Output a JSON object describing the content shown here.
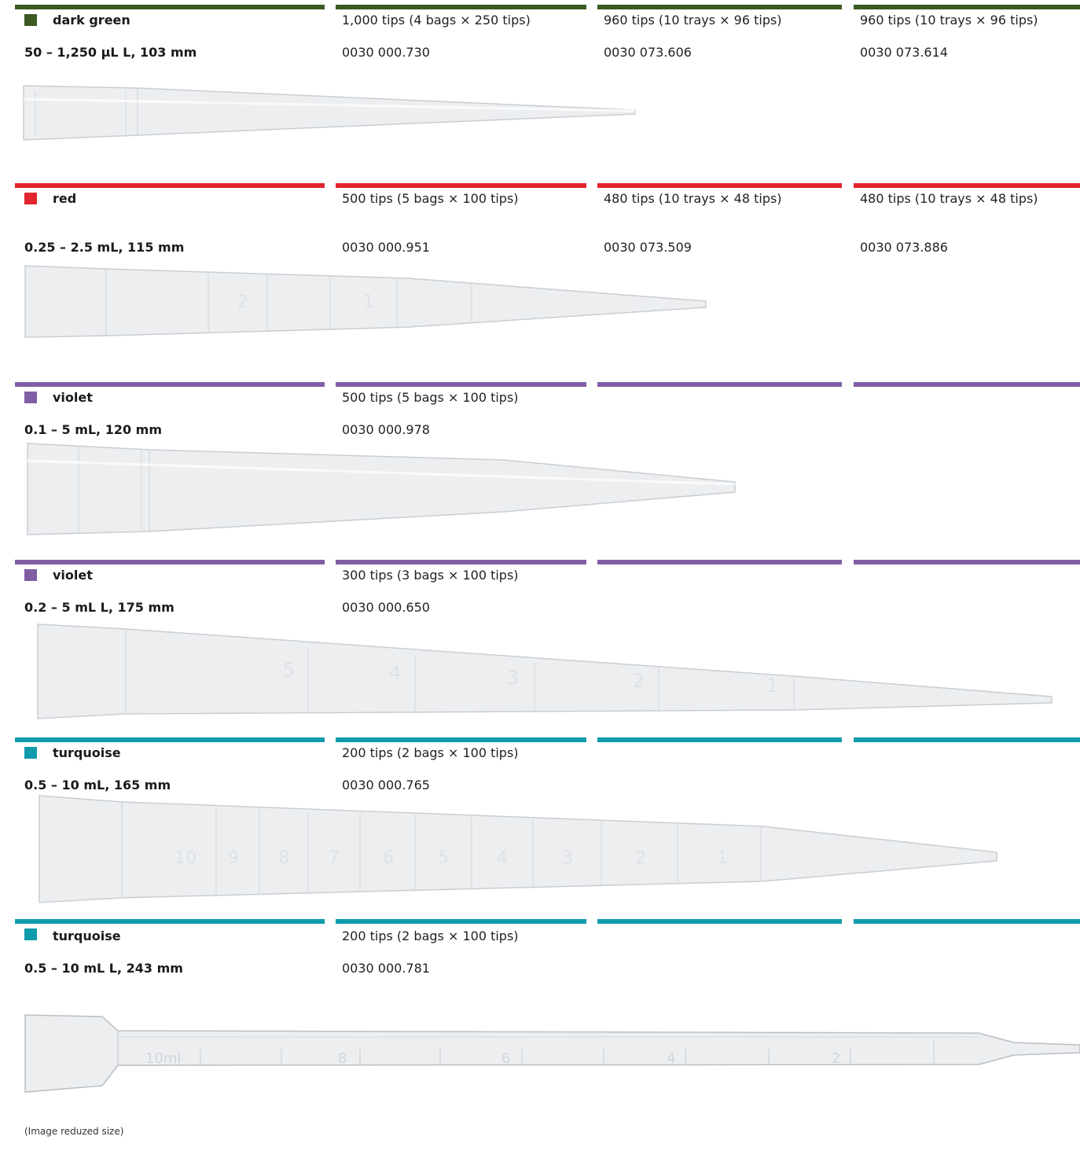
{
  "colors": {
    "dark_green": "#3c5a21",
    "red": "#e1242e",
    "violet": "#7f5ea4",
    "turquoise": "#0f9bab"
  },
  "rows": [
    {
      "color_name": "dark green",
      "spec": "50 – 1,250 µL L, 103 mm",
      "pack_1": "1,000 tips (4 bags × 250 tips)",
      "pack_2": "960 tips (10 trays × 96 tips)",
      "pack_3": "960 tips (10 trays × 96 tips)",
      "order_1": "0030 000.730",
      "order_2": "0030 073.606",
      "order_3": "0030 073.614"
    },
    {
      "color_name": "red",
      "spec": "0.25 – 2.5 mL, 115 mm",
      "pack_1": "500 tips (5 bags × 100 tips)",
      "pack_2": "480 tips (10 trays × 48 tips)",
      "pack_3": "480 tips (10 trays × 48 tips)",
      "order_1": "0030 000.951",
      "order_2": "0030 073.509",
      "order_3": "0030 073.886",
      "marks": [
        "2",
        "1"
      ]
    },
    {
      "color_name": "violet",
      "spec": "0.1 – 5 mL, 120 mm",
      "pack_1": "500 tips (5 bags × 100 tips)",
      "order_1": "0030 000.978"
    },
    {
      "color_name": "violet",
      "spec": "0.2 – 5 mL L, 175 mm",
      "pack_1": "300 tips (3 bags × 100 tips)",
      "order_1": "0030 000.650",
      "marks": [
        "5",
        "4",
        "3",
        "2",
        "1"
      ]
    },
    {
      "color_name": "turquoise",
      "spec": "0.5 – 10 mL, 165 mm",
      "pack_1": "200 tips (2 bags × 100 tips)",
      "order_1": "0030 000.765",
      "marks": [
        "10",
        "9",
        "8",
        "7",
        "6",
        "5",
        "4",
        "3",
        "2",
        "1"
      ]
    },
    {
      "color_name": "turquoise",
      "spec": "0.5 – 10 mL L, 243 mm",
      "pack_1": "200 tips (2 bags × 100 tips)",
      "order_1": "0030 000.781",
      "marks": [
        "10ml",
        "8",
        "6",
        "4",
        "2"
      ]
    }
  ],
  "caption": "(Image reduzed size)"
}
